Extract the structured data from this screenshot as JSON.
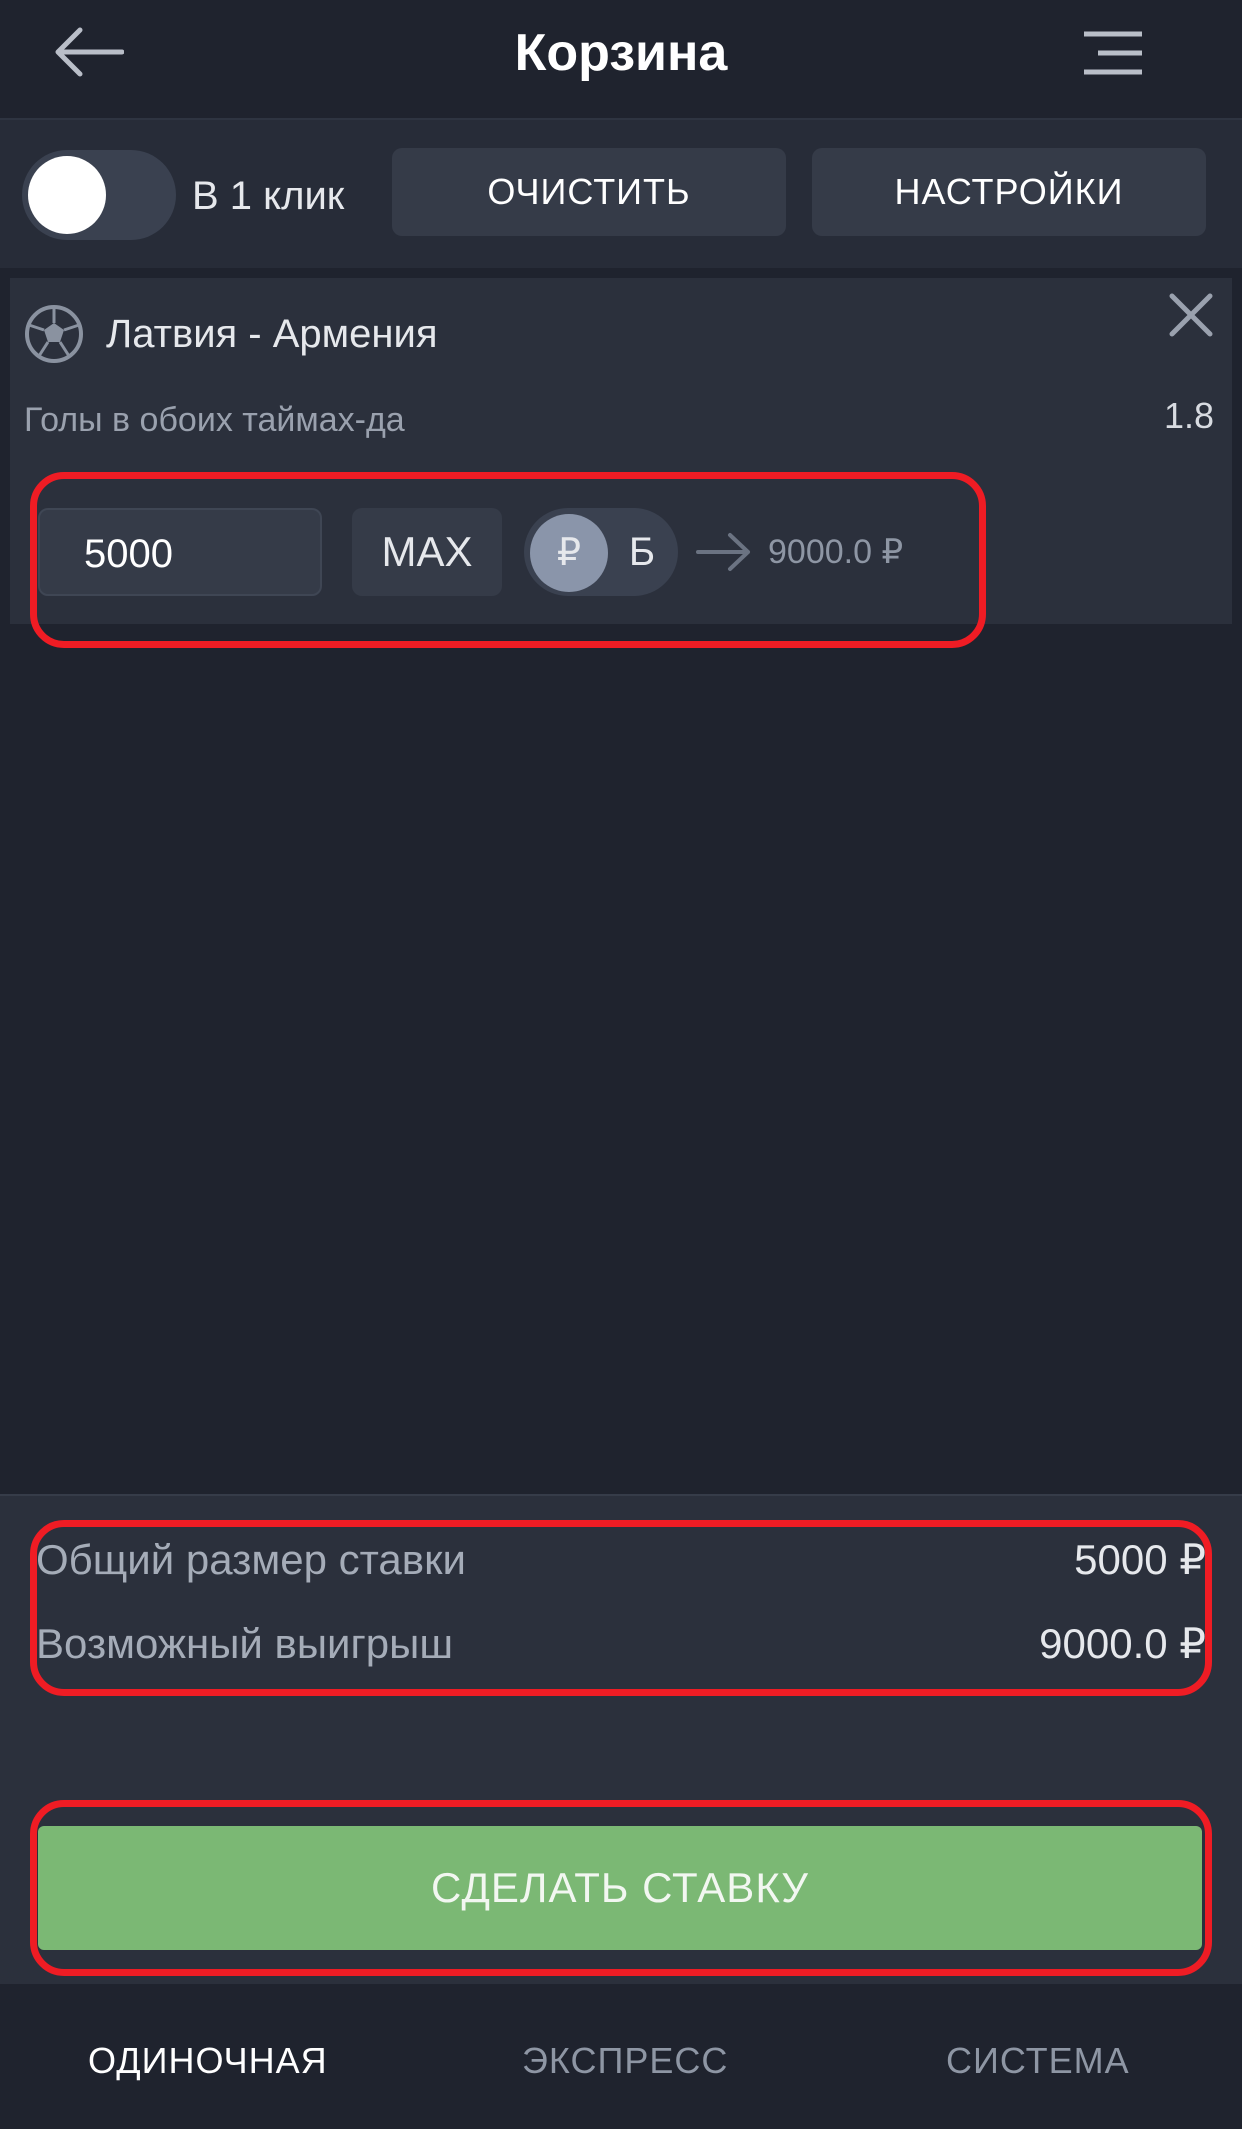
{
  "header": {
    "title": "Корзина",
    "back_icon": "arrow-left-icon",
    "menu_icon": "hamburger-menu-icon"
  },
  "toolbar": {
    "one_click_toggle_on": false,
    "one_click_label": "В 1 клик",
    "clear_label": "ОЧИСТИТЬ",
    "settings_label": "НАСТРОЙКИ"
  },
  "bet": {
    "sport_icon": "soccer-ball-icon",
    "event": "Латвия - Армения",
    "market": "Голы в обоих таймах-да",
    "odds": "1.8",
    "stake": "5000",
    "max_label": "MAX",
    "currency_selected": "₽",
    "currency_alt": "Б",
    "payout": "9000.0 ₽"
  },
  "summary": {
    "total_stake_label": "Общий размер ставки",
    "total_stake_value": "5000 ₽",
    "possible_win_label": "Возможный выигрыш",
    "possible_win_value": "9000.0 ₽",
    "place_bet_label": "СДЕЛАТЬ СТАВКУ"
  },
  "tabs": [
    {
      "label": "ОДИНОЧНАЯ",
      "active": true
    },
    {
      "label": "ЭКСПРЕСС",
      "active": false
    },
    {
      "label": "СИСТЕМА",
      "active": false
    }
  ],
  "colors": {
    "background": "#1f232e",
    "panel": "#2b303c",
    "button": "#353b48",
    "accent_green": "#7bb874",
    "highlight_red": "#ef1c24",
    "active_tab": "#ffffff",
    "inactive_tab": "#8e96a4"
  }
}
